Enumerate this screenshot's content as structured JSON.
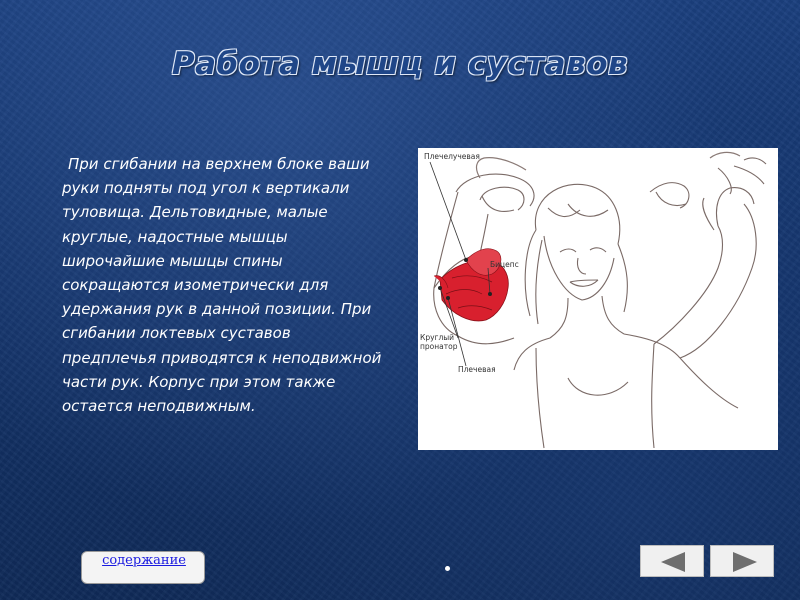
{
  "slide": {
    "title": "Работа мышц и суставов",
    "body": "При сгибании на верхнем блоке ваши руки подняты под угол к вертикали туловища. Дельтовидные, малые круглые, надостные мышцы широчайшие мышцы спины сокращаются изометрически для удержания рук в данной позиции. При сгибании локтевых суставов предплечья приводятся к неподвижной части рук. Корпус при этом также остается неподвижным."
  },
  "figure": {
    "labels": {
      "brachioradialis": "Плечелучевая",
      "biceps": "Бицепс",
      "pronator_line1": "Круглый",
      "pronator_line2": "пронатор",
      "brachialis": "Плечевая"
    },
    "muscle_color": "#d8202e"
  },
  "navigation": {
    "toc_label": "содержание",
    "prev_icon": "left-triangle-icon",
    "next_icon": "right-triangle-icon"
  }
}
